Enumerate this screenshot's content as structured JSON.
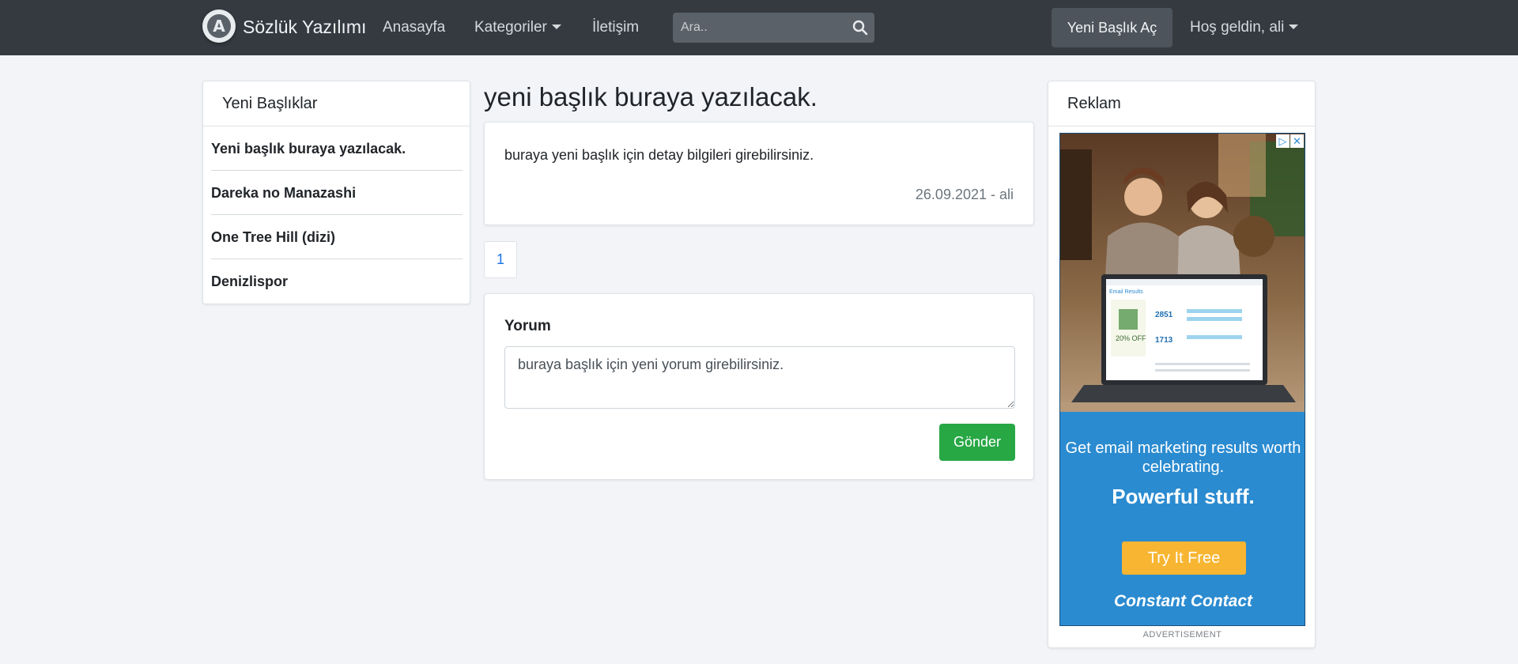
{
  "navbar": {
    "brand_name": "Sözlük Yazılımı",
    "links": [
      "Anasayfa",
      "Kategoriler",
      "İletişim"
    ],
    "search_placeholder": "Ara..",
    "new_topic_label": "Yeni Başlık Aç",
    "user_menu_label": "Hoş geldin, ali"
  },
  "sidebar": {
    "title": "Yeni Başlıklar",
    "items": [
      "Yeni başlık buraya yazılacak.",
      "Dareka no Manazashi",
      "One Tree Hill (dizi)",
      "Denizlispor"
    ]
  },
  "main": {
    "title": "yeni başlık buraya yazılacak.",
    "entry_text": "buraya yeni başlık için detay bilgileri girebilirsiniz.",
    "entry_meta": "26.09.2021 - ali",
    "page_number": "1",
    "comment_label": "Yorum",
    "comment_value": "buraya başlık için yeni yorum girebilirsiniz.",
    "send_label": "Gönder"
  },
  "ad": {
    "title": "Reklam",
    "line1": "Get email marketing results worth celebrating.",
    "line2": "Powerful stuff.",
    "cta": "Try It Free",
    "brand": "Constant Contact",
    "caption": "ADVERTISEMENT",
    "mock_email_title": "Email Results",
    "mock_stat1": "2851",
    "mock_stat2": "1713",
    "mock_promo": "20% OFF"
  },
  "colors": {
    "navbar_bg": "#343a40",
    "page_bg": "#f2f4f8",
    "send_button": "#28a745",
    "ad_bg": "#2b8bd0",
    "ad_cta": "#f7b531"
  }
}
